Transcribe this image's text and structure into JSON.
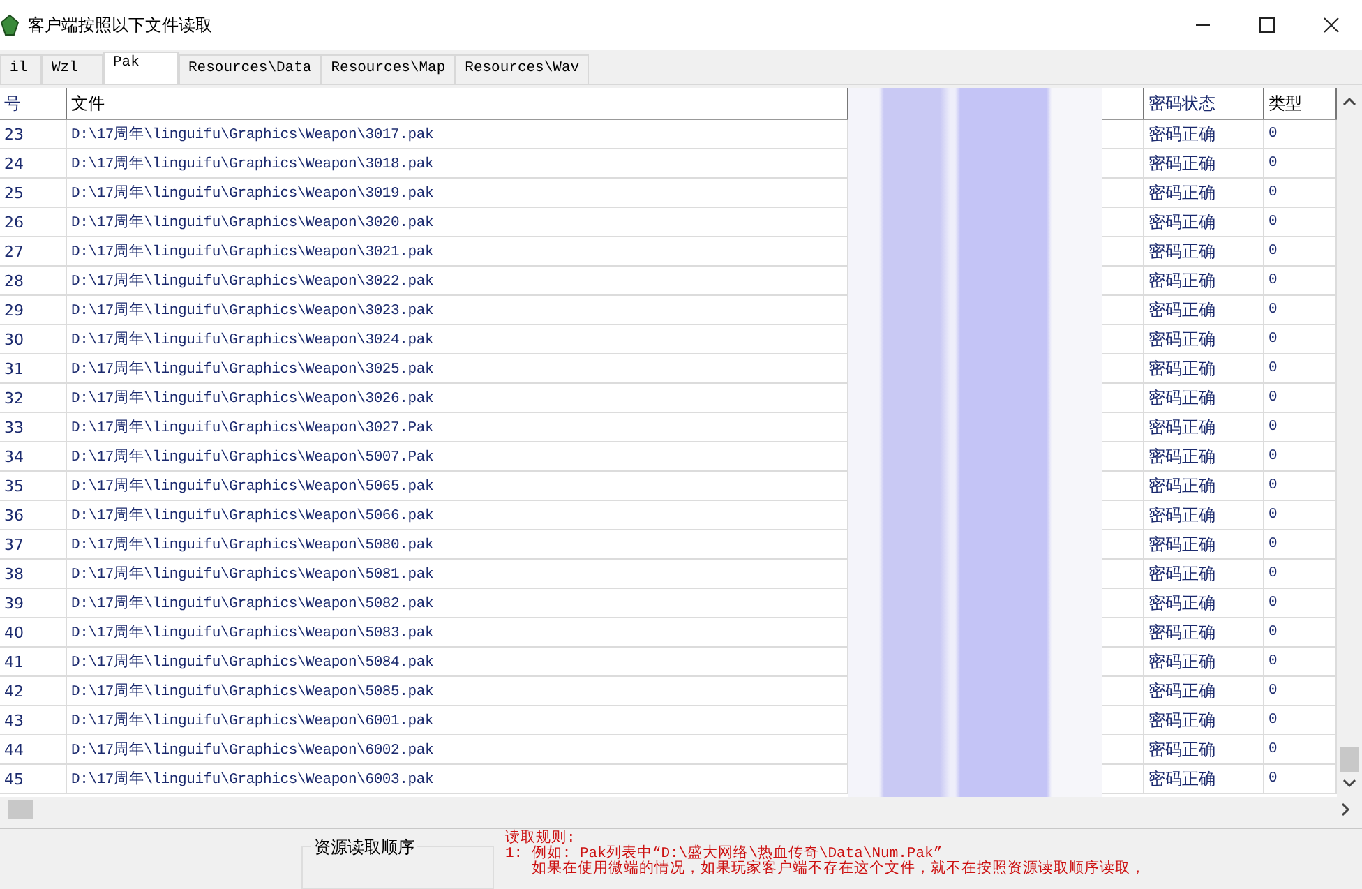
{
  "window": {
    "title": "客户端按照以下文件读取"
  },
  "tabs": [
    {
      "label": "il",
      "selected": false
    },
    {
      "label": "Wzl",
      "selected": false
    },
    {
      "label": "Pak",
      "selected": true
    },
    {
      "label": "Resources\\Data",
      "selected": false
    },
    {
      "label": "Resources\\Map",
      "selected": false
    },
    {
      "label": "Resources\\Wav",
      "selected": false
    }
  ],
  "table": {
    "columns": [
      "号",
      "文件",
      "密码状态",
      "类型"
    ],
    "rows": [
      {
        "number": "23",
        "file": "D:\\17周年\\linguifu\\Graphics\\Weapon\\3017.pak",
        "status": "密码正确",
        "type": "0"
      },
      {
        "number": "24",
        "file": "D:\\17周年\\linguifu\\Graphics\\Weapon\\3018.pak",
        "status": "密码正确",
        "type": "0"
      },
      {
        "number": "25",
        "file": "D:\\17周年\\linguifu\\Graphics\\Weapon\\3019.pak",
        "status": "密码正确",
        "type": "0"
      },
      {
        "number": "26",
        "file": "D:\\17周年\\linguifu\\Graphics\\Weapon\\3020.pak",
        "status": "密码正确",
        "type": "0"
      },
      {
        "number": "27",
        "file": "D:\\17周年\\linguifu\\Graphics\\Weapon\\3021.pak",
        "status": "密码正确",
        "type": "0"
      },
      {
        "number": "28",
        "file": "D:\\17周年\\linguifu\\Graphics\\Weapon\\3022.pak",
        "status": "密码正确",
        "type": "0"
      },
      {
        "number": "29",
        "file": "D:\\17周年\\linguifu\\Graphics\\Weapon\\3023.pak",
        "status": "密码正确",
        "type": "0"
      },
      {
        "number": "30",
        "file": "D:\\17周年\\linguifu\\Graphics\\Weapon\\3024.pak",
        "status": "密码正确",
        "type": "0"
      },
      {
        "number": "31",
        "file": "D:\\17周年\\linguifu\\Graphics\\Weapon\\3025.pak",
        "status": "密码正确",
        "type": "0"
      },
      {
        "number": "32",
        "file": "D:\\17周年\\linguifu\\Graphics\\Weapon\\3026.pak",
        "status": "密码正确",
        "type": "0"
      },
      {
        "number": "33",
        "file": "D:\\17周年\\linguifu\\Graphics\\Weapon\\3027.Pak",
        "status": "密码正确",
        "type": "0"
      },
      {
        "number": "34",
        "file": "D:\\17周年\\linguifu\\Graphics\\Weapon\\5007.Pak",
        "status": "密码正确",
        "type": "0"
      },
      {
        "number": "35",
        "file": "D:\\17周年\\linguifu\\Graphics\\Weapon\\5065.pak",
        "status": "密码正确",
        "type": "0"
      },
      {
        "number": "36",
        "file": "D:\\17周年\\linguifu\\Graphics\\Weapon\\5066.pak",
        "status": "密码正确",
        "type": "0"
      },
      {
        "number": "37",
        "file": "D:\\17周年\\linguifu\\Graphics\\Weapon\\5080.pak",
        "status": "密码正确",
        "type": "0"
      },
      {
        "number": "38",
        "file": "D:\\17周年\\linguifu\\Graphics\\Weapon\\5081.pak",
        "status": "密码正确",
        "type": "0"
      },
      {
        "number": "39",
        "file": "D:\\17周年\\linguifu\\Graphics\\Weapon\\5082.pak",
        "status": "密码正确",
        "type": "0"
      },
      {
        "number": "40",
        "file": "D:\\17周年\\linguifu\\Graphics\\Weapon\\5083.pak",
        "status": "密码正确",
        "type": "0"
      },
      {
        "number": "41",
        "file": "D:\\17周年\\linguifu\\Graphics\\Weapon\\5084.pak",
        "status": "密码正确",
        "type": "0"
      },
      {
        "number": "42",
        "file": "D:\\17周年\\linguifu\\Graphics\\Weapon\\5085.pak",
        "status": "密码正确",
        "type": "0"
      },
      {
        "number": "43",
        "file": "D:\\17周年\\linguifu\\Graphics\\Weapon\\6001.pak",
        "status": "密码正确",
        "type": "0"
      },
      {
        "number": "44",
        "file": "D:\\17周年\\linguifu\\Graphics\\Weapon\\6002.pak",
        "status": "密码正确",
        "type": "0"
      },
      {
        "number": "45",
        "file": "D:\\17周年\\linguifu\\Graphics\\Weapon\\6003.pak",
        "status": "密码正确",
        "type": "0"
      }
    ]
  },
  "order_panel": {
    "title": "资源读取顺序"
  },
  "rules": [
    "读取规则:",
    "1: 例如: Pak列表中“D:\\盛大网络\\热血传奇\\Data\\Num.Pak”",
    "如果在使用微端的情况，如果玩家客户端不存在这个文件，就不在按照资源读取顺序读取，"
  ]
}
